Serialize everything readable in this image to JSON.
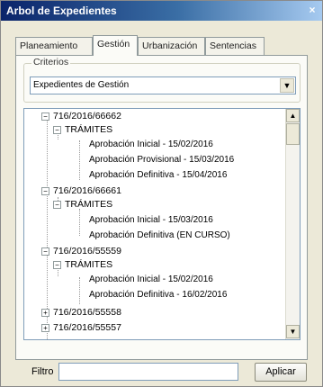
{
  "window": {
    "title": "Arbol de Expedientes",
    "close_label": "×"
  },
  "tabs": [
    {
      "label": "Planeamiento",
      "active": false
    },
    {
      "label": "Gestión",
      "active": true
    },
    {
      "label": "Urbanización",
      "active": false
    },
    {
      "label": "Sentencias",
      "active": false
    }
  ],
  "criteria": {
    "legend": "Criterios",
    "selected": "Expedientes de Gestión"
  },
  "tree": [
    {
      "label": "716/2016/66662",
      "expander": "−"
    },
    {
      "label": "TRÁMITES",
      "expander": "−"
    },
    {
      "label": "Aprobación Inicial - 15/02/2016"
    },
    {
      "label": "Aprobación Provisional - 15/03/2016"
    },
    {
      "label": "Aprobación Definitiva - 15/04/2016"
    },
    {
      "label": "716/2016/66661",
      "expander": "−"
    },
    {
      "label": "TRÁMITES",
      "expander": "−"
    },
    {
      "label": "Aprobación Inicial - 15/03/2016"
    },
    {
      "label": "Aprobación Definitiva (EN CURSO)"
    },
    {
      "label": "716/2016/55559",
      "expander": "−"
    },
    {
      "label": "TRÁMITES",
      "expander": "−"
    },
    {
      "label": "Aprobación Inicial - 15/02/2016"
    },
    {
      "label": "Aprobación Definitiva - 16/02/2016"
    },
    {
      "label": "716/2016/55558",
      "expander": "+"
    },
    {
      "label": "716/2016/55557",
      "expander": "+"
    }
  ],
  "filter": {
    "label": "Filtro",
    "value": "",
    "apply_label": "Aplicar"
  }
}
